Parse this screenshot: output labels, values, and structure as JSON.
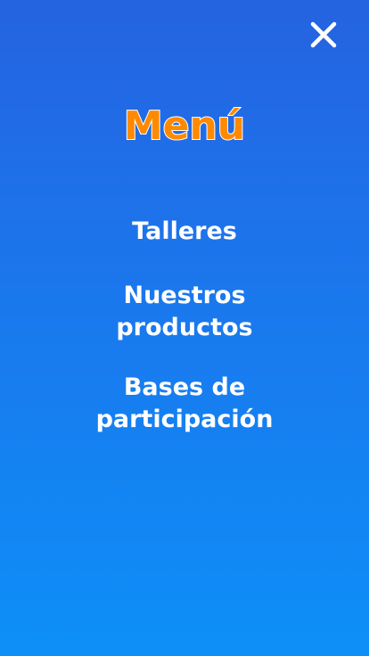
{
  "header": {
    "close_icon": "close-icon"
  },
  "menu": {
    "title": "Menú",
    "items": [
      {
        "label_lines": [
          "Talleres"
        ]
      },
      {
        "label_lines": [
          "Nuestros",
          "productos"
        ]
      },
      {
        "label_lines": [
          "Bases de",
          "participación"
        ]
      }
    ]
  },
  "colors": {
    "background_top": "#2563e0",
    "background_bottom": "#0d8ff8",
    "title": "#ff8a00",
    "text": "#ffffff"
  }
}
